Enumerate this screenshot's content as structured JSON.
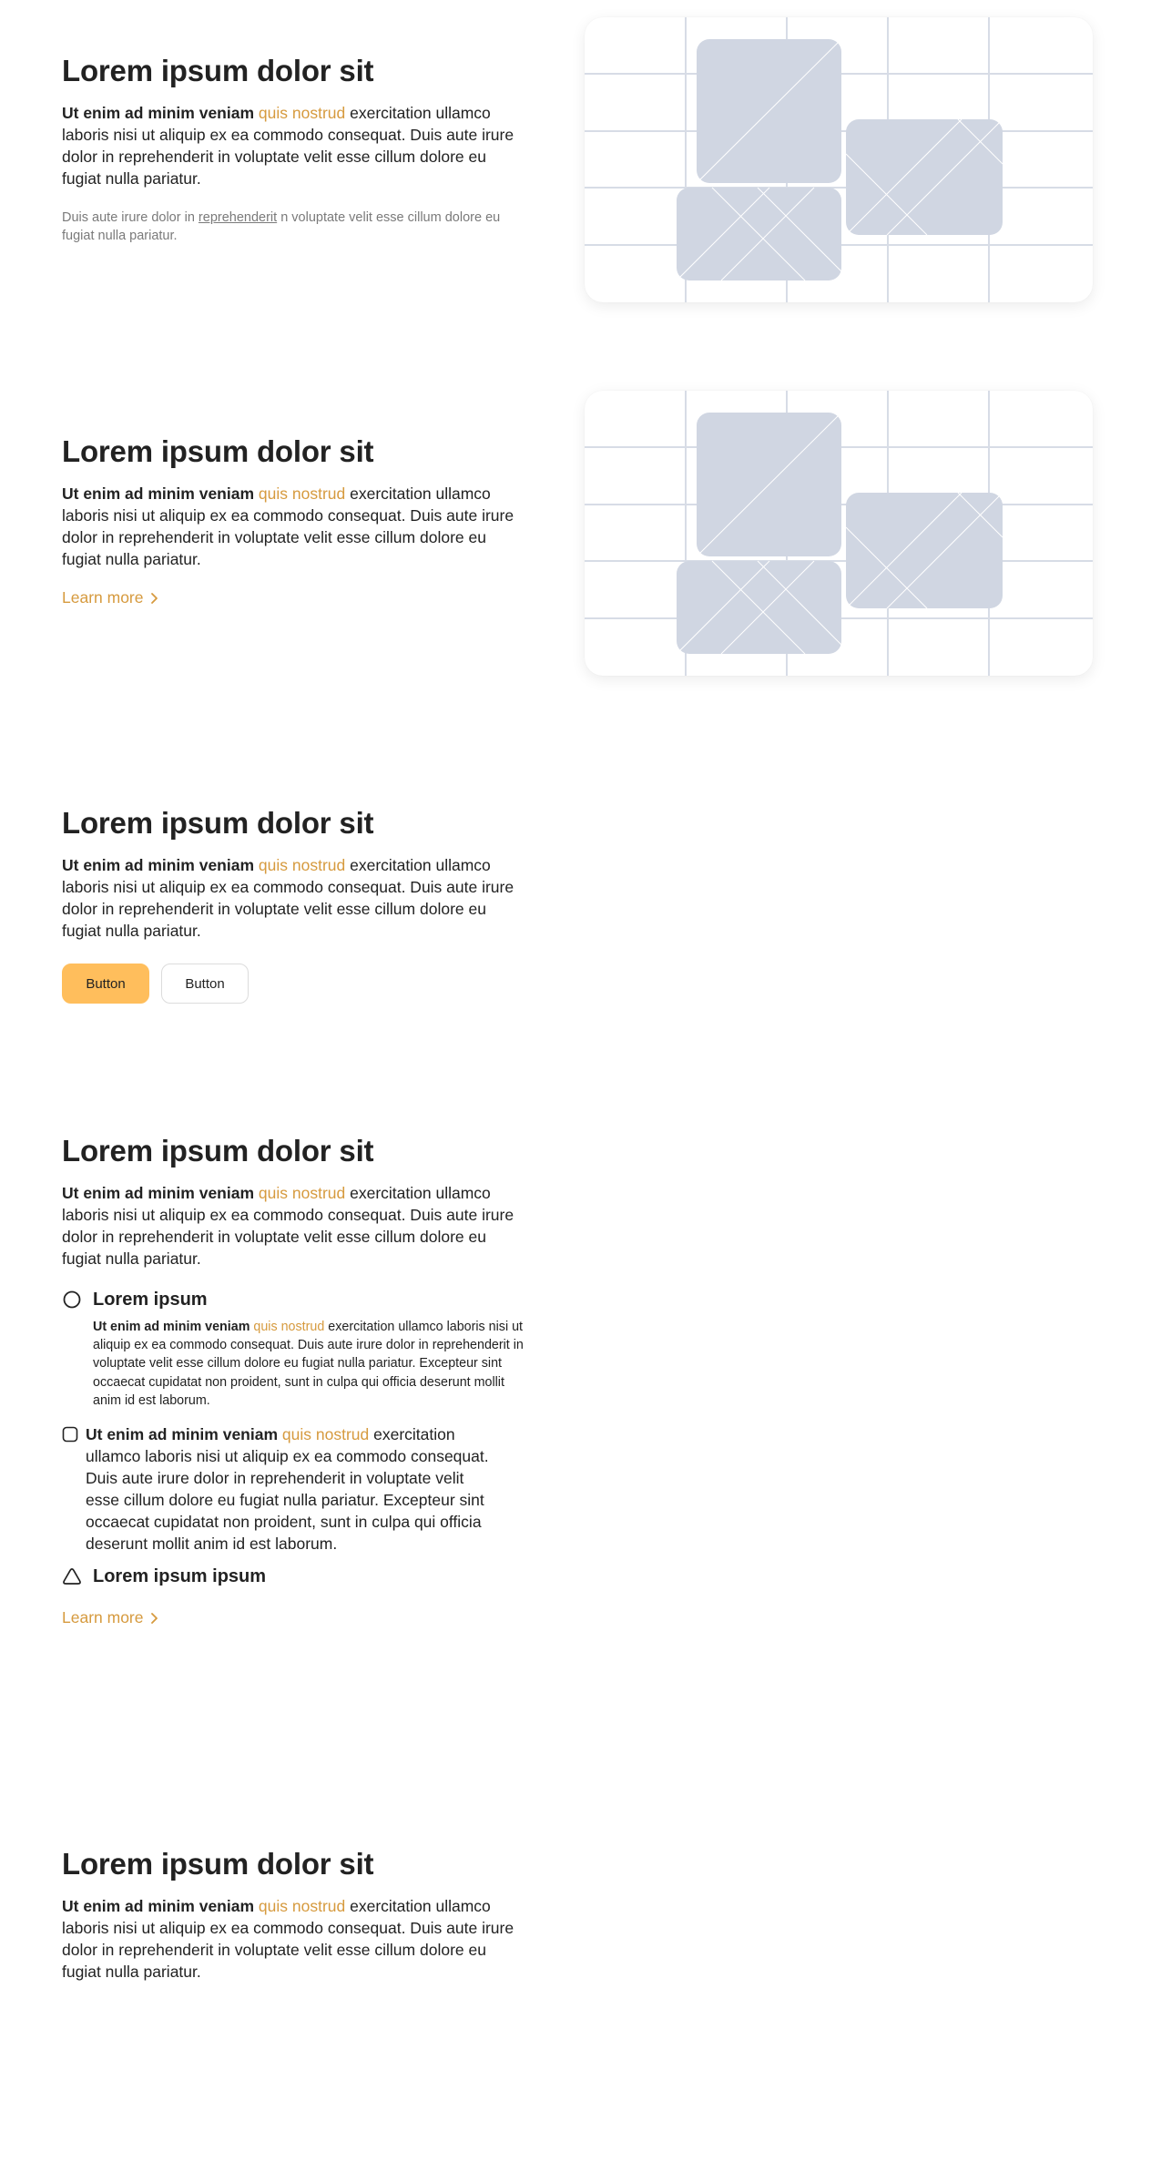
{
  "colors": {
    "accent": "#d69a3e",
    "button_primary": "#ffbe5c",
    "placeholder": "#d0d6e2",
    "grid": "#d7dce6"
  },
  "sections": [
    {
      "title": "Lorem ipsum dolor sit",
      "lead_bold": "Ut enim ad minim veniam",
      "lead_accent": "quis nostrud",
      "lead_rest": "exercitation ullamco laboris nisi ut aliquip ex ea commodo consequat. Duis aute irure dolor in reprehenderit in voluptate velit esse cillum dolore eu fugiat nulla pariatur.",
      "note_pre": "Duis aute irure dolor in",
      "note_link": "reprehenderit",
      "note_post": "n voluptate velit esse cillum dolore eu fugiat nulla pariatur."
    },
    {
      "title": "Lorem ipsum dolor sit",
      "lead_bold": "Ut enim ad minim veniam",
      "lead_accent": "quis nostrud",
      "lead_rest": "exercitation ullamco laboris nisi ut aliquip ex ea commodo consequat. Duis aute irure dolor in reprehenderit in voluptate velit esse cillum dolore eu fugiat nulla pariatur.",
      "link_label": "Learn more"
    },
    {
      "title": "Lorem ipsum dolor sit",
      "lead_bold": "Ut enim ad minim veniam",
      "lead_accent": "quis nostrud",
      "lead_rest": "exercitation ullamco laboris nisi ut aliquip ex ea commodo consequat. Duis aute irure dolor in reprehenderit in voluptate velit esse cillum dolore eu fugiat nulla pariatur.",
      "primary_button": "Button",
      "secondary_button": "Button"
    },
    {
      "title": "Lorem ipsum dolor sit",
      "lead_bold": "Ut enim ad minim veniam",
      "lead_accent": "quis nostrud",
      "lead_rest": "exercitation ullamco laboris nisi ut aliquip ex ea commodo consequat. Duis aute irure dolor in reprehenderit in voluptate velit esse cillum dolore eu fugiat nulla pariatur.",
      "features": [
        {
          "icon": "circle-icon",
          "title": "Lorem ipsum",
          "body_bold": "Ut enim ad minim veniam",
          "body_accent": "quis nostrud",
          "body_rest": "exercitation ullamco laboris nisi ut aliquip ex ea commodo consequat. Duis aute irure dolor in reprehenderit in voluptate velit esse cillum dolore eu fugiat nulla pariatur. Excepteur sint occaecat cupidatat non proident, sunt in culpa qui officia deserunt mollit anim id est laborum."
        },
        {
          "icon": "square-icon",
          "body_bold": "Ut enim ad minim veniam",
          "body_accent": "quis nostrud",
          "body_rest": "exercitation ullamco laboris nisi ut aliquip ex ea commodo consequat. Duis aute irure dolor in reprehenderit in voluptate velit esse cillum dolore eu fugiat nulla pariatur. Excepteur sint occaecat cupidatat non proident, sunt in culpa qui officia deserunt mollit anim id est laborum."
        },
        {
          "icon": "triangle-icon",
          "title": "Lorem ipsum ipsum"
        }
      ],
      "link_label": "Learn more"
    },
    {
      "title": "Lorem ipsum dolor sit",
      "lead_bold": "Ut enim ad minim veniam",
      "lead_accent": "quis nostrud",
      "lead_rest": "exercitation ullamco laboris nisi ut aliquip ex ea commodo consequat. Duis aute irure dolor in reprehenderit in voluptate velit esse cillum dolore eu fugiat nulla pariatur."
    }
  ]
}
